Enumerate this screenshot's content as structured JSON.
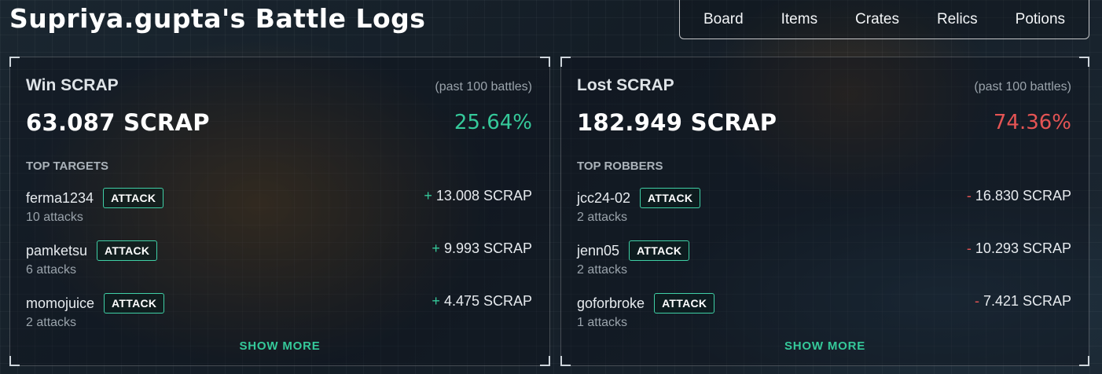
{
  "page": {
    "title": "Supriya.gupta's Battle Logs"
  },
  "nav": {
    "items": [
      {
        "label": "Board"
      },
      {
        "label": "Items"
      },
      {
        "label": "Crates"
      },
      {
        "label": "Relics"
      },
      {
        "label": "Potions"
      }
    ]
  },
  "colors": {
    "positive": "#35c99a",
    "negative": "#e45454",
    "accent_border": "#3fd0a6"
  },
  "win": {
    "title": "Win SCRAP",
    "period": "(past 100 battles)",
    "amount": "63.087 SCRAP",
    "percent": "25.64%",
    "section_label": "TOP TARGETS",
    "rows": [
      {
        "name": "ferma1234",
        "action": "ATTACK",
        "sign": "+",
        "amount": "13.008 SCRAP",
        "sub": "10 attacks"
      },
      {
        "name": "pamketsu",
        "action": "ATTACK",
        "sign": "+",
        "amount": "9.993 SCRAP",
        "sub": "6 attacks"
      },
      {
        "name": "momojuice",
        "action": "ATTACK",
        "sign": "+",
        "amount": "4.475 SCRAP",
        "sub": "2 attacks"
      }
    ],
    "show_more": "SHOW MORE"
  },
  "lost": {
    "title": "Lost SCRAP",
    "period": "(past 100 battles)",
    "amount": "182.949 SCRAP",
    "percent": "74.36%",
    "section_label": "TOP ROBBERS",
    "rows": [
      {
        "name": "jcc24-02",
        "action": "ATTACK",
        "sign": "-",
        "amount": "16.830 SCRAP",
        "sub": "2 attacks"
      },
      {
        "name": "jenn05",
        "action": "ATTACK",
        "sign": "-",
        "amount": "10.293 SCRAP",
        "sub": "2 attacks"
      },
      {
        "name": "goforbroke",
        "action": "ATTACK",
        "sign": "-",
        "amount": "7.421 SCRAP",
        "sub": "1 attacks"
      }
    ],
    "show_more": "SHOW MORE"
  }
}
